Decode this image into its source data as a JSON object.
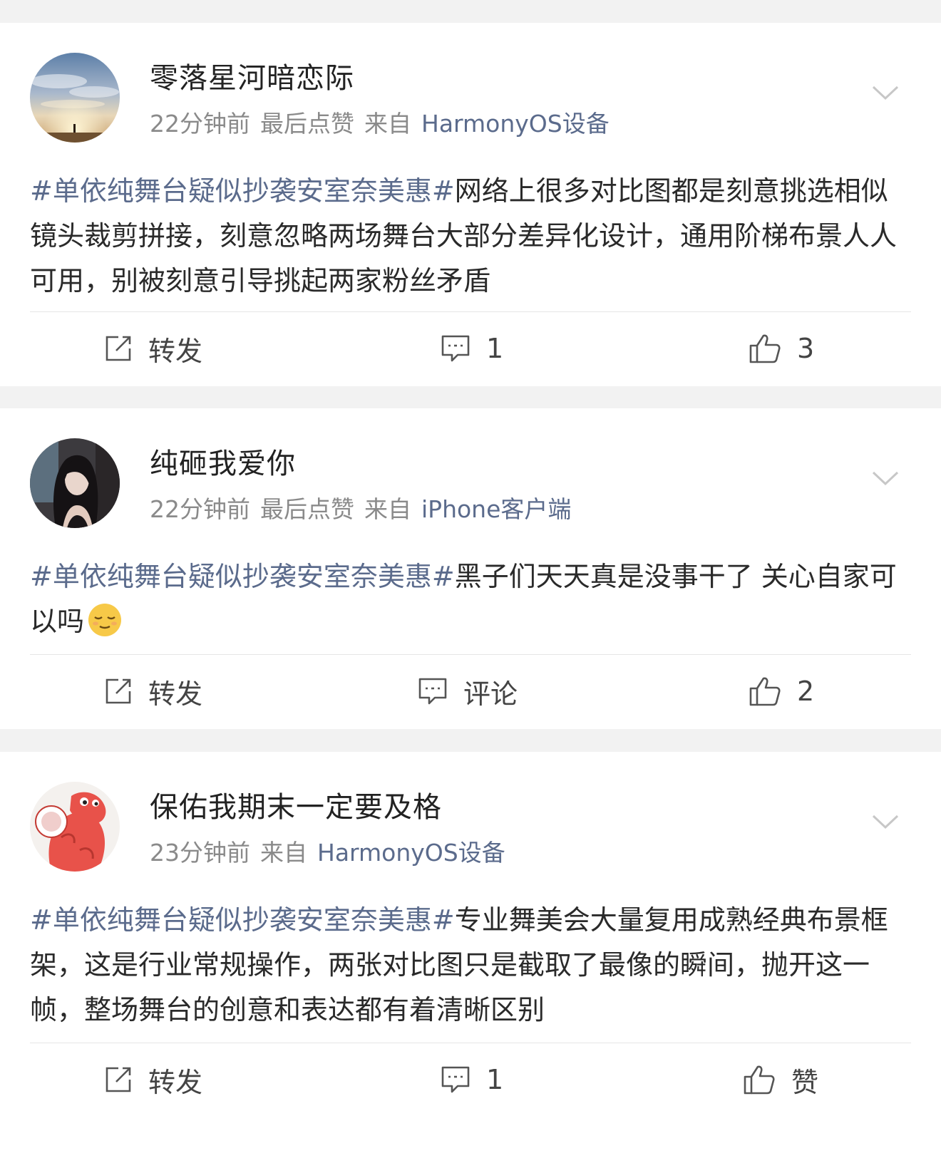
{
  "posts": [
    {
      "username": "零落星河暗恋际",
      "time": "22分钟前",
      "liked_label": "最后点赞",
      "from_label": "来自",
      "source": "HarmonyOS设备",
      "hashtag": "#单依纯舞台疑似抄袭安室奈美惠#",
      "text": "网络上很多对比图都是刻意挑选相似镜头裁剪拼接，刻意忽略两场舞台大部分差异化设计，通用阶梯布景人人可用，别被刻意引导挑起两家粉丝矛盾",
      "repost_label": "转发",
      "comment_label": "1",
      "like_label": "3"
    },
    {
      "username": "纯砸我爱你",
      "time": "22分钟前",
      "liked_label": "最后点赞",
      "from_label": "来自",
      "source": "iPhone客户端",
      "hashtag": "#单依纯舞台疑似抄袭安室奈美惠#",
      "text": "黑子们天天真是没事干了 关心自家可以吗",
      "emoji": "relieved-face",
      "repost_label": "转发",
      "comment_label": "评论",
      "like_label": "2"
    },
    {
      "username": "保佑我期末一定要及格",
      "time": "23分钟前",
      "from_label": "来自",
      "source": "HarmonyOS设备",
      "hashtag": "#单依纯舞台疑似抄袭安室奈美惠#",
      "text": "专业舞美会大量复用成熟经典布景框架，这是行业常规操作，两张对比图只是截取了最像的瞬间，抛开这一帧，整场舞台的创意和表达都有着清晰区别",
      "repost_label": "转发",
      "comment_label": "1",
      "like_label": "赞"
    }
  ],
  "colors": {
    "link": "#5b6b8c",
    "meta": "#8a8a8a",
    "background": "#f2f2f2"
  },
  "icons": {
    "repost": "repost-icon",
    "comment": "comment-icon",
    "like": "thumbs-up-icon",
    "more": "chevron-down-icon"
  }
}
